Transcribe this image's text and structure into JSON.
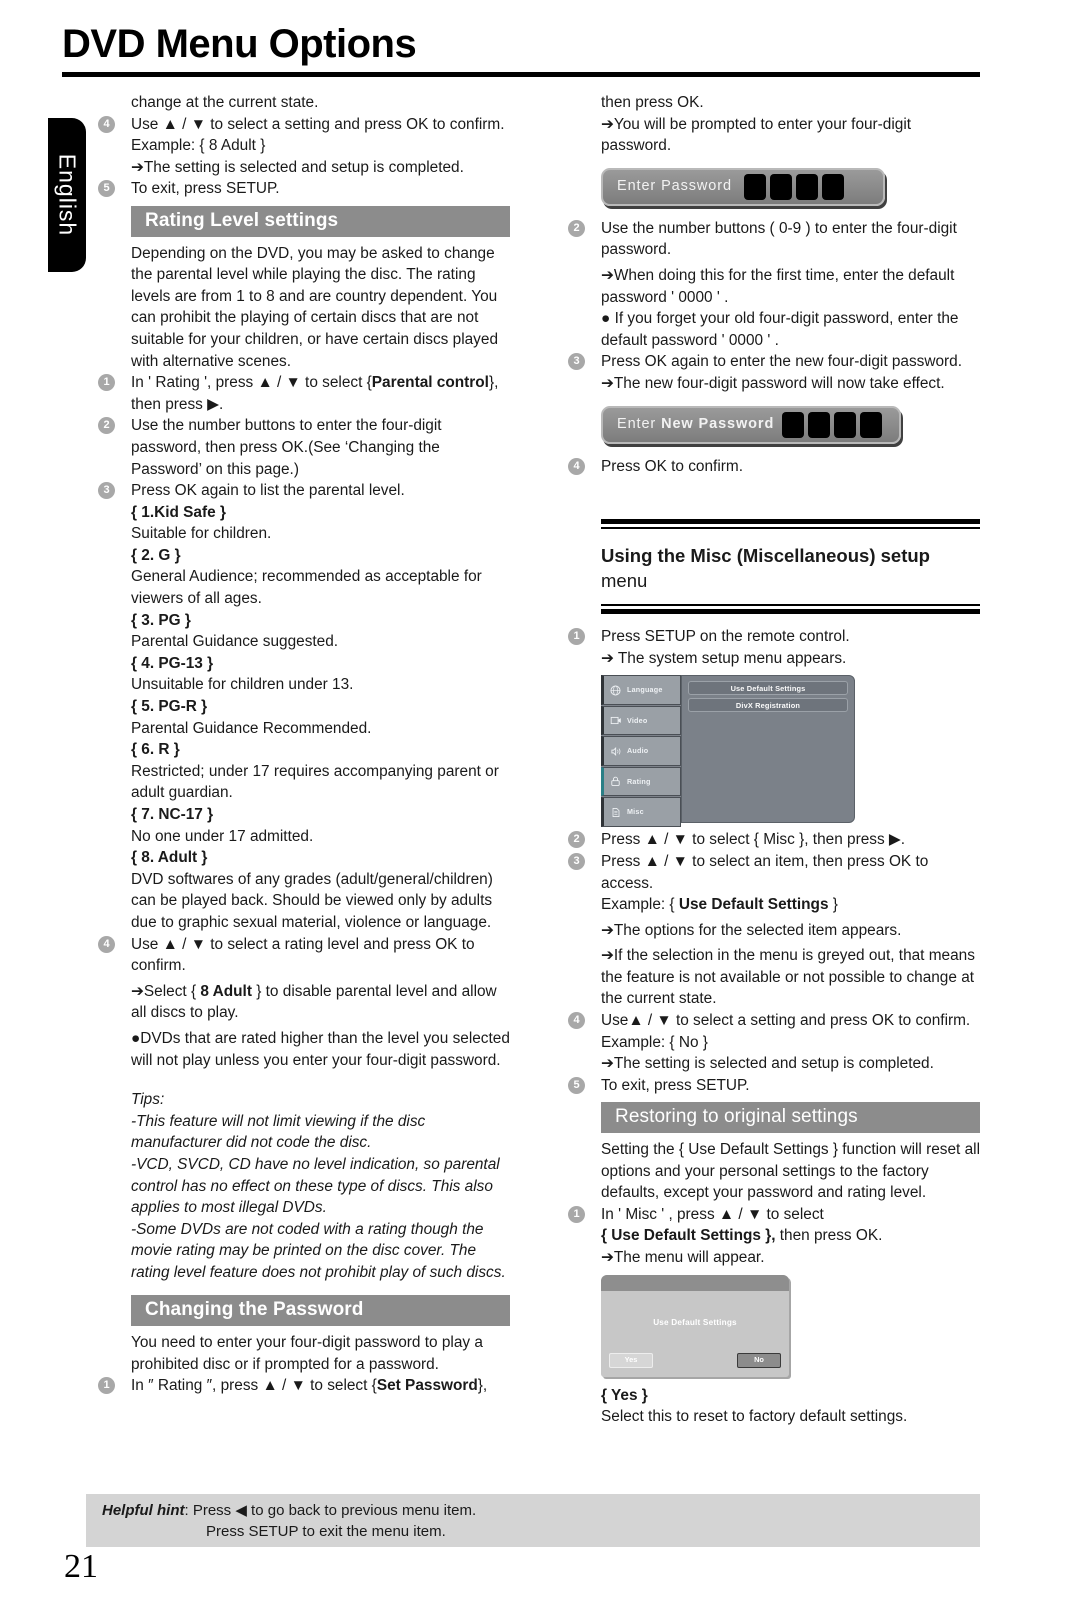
{
  "header": {
    "title": "DVD Menu Options"
  },
  "language_tab": {
    "label": "English"
  },
  "page_number": "21",
  "left_column": {
    "cont_text": "change at the current state.",
    "step4": "Use ▲ / ▼ to select a setting and press OK to confirm.",
    "step4_example": "Example: { 8 Adult }",
    "step4_arrow": "➔The setting is selected and setup is completed.",
    "step5": "To exit, press SETUP.",
    "rating_band": "Rating Level settings",
    "rating_intro": "Depending on the DVD, you may be asked to change the parental level while playing the disc. The rating levels are from 1 to 8 and are country dependent. You can prohibit the playing of certain discs that are not suitable for your children, or have certain discs played with alternative scenes.",
    "r_step1_a": "In ' Rating ', press ▲ / ▼ to select {",
    "r_step1_b": "Parental control",
    "r_step1_c": "}, then press ▶.",
    "r_step2": "Use the number buttons to enter the four-digit password, then press OK.(See ‘Changing the Password’ on this page.)",
    "r_step3": "Press OK again to list the parental level.",
    "levels": [
      {
        "name": "{ 1.Kid Safe }",
        "desc": "Suitable for children."
      },
      {
        "name": "{ 2. G }",
        "desc": "General Audience; recommended as acceptable for viewers of all ages."
      },
      {
        "name": "{ 3. PG }",
        "desc": "Parental Guidance suggested."
      },
      {
        "name": "{ 4. PG-13 }",
        "desc": "Unsuitable for children under 13."
      },
      {
        "name": "{ 5. PG-R }",
        "desc": "Parental Guidance Recommended."
      },
      {
        "name": "{ 6. R }",
        "desc": "Restricted; under 17 requires accompanying parent or adult guardian."
      },
      {
        "name": "{ 7. NC-17 }",
        "desc": "No one under 17 admitted."
      },
      {
        "name": "{ 8. Adult }",
        "desc": "DVD softwares of any grades (adult/general/children) can be played back. Should be viewed only by adults due to graphic sexual material, violence or language."
      }
    ],
    "r_step4": "Use ▲ / ▼ to select a rating level and press OK to confirm.",
    "r_step4_arrow_a": "➔Select { ",
    "r_step4_arrow_b": "8 Adult",
    "r_step4_arrow_c": " } to disable parental level and allow all discs to play.",
    "r_step4_bullet": "●DVDs that are rated higher than the level you selected will not play unless you enter your four-digit password.",
    "tips_label": "Tips:",
    "tips": [
      "-This feature will not limit viewing if the disc manufacturer did not code the disc.",
      "-VCD, SVCD, CD have no level indication, so parental control has no effect on these type of discs. This also applies to most illegal DVDs.",
      "-Some DVDs are not coded with a rating though the movie rating may be printed on the disc cover. The rating level feature does not prohibit play of such discs."
    ],
    "password_band": "Changing the Password",
    "password_intro": "You need to enter your four-digit password to play a prohibited disc or if prompted for a password.",
    "p_step1_a": "In ″ Rating ″, press ▲ / ▼ to select {",
    "p_step1_b": "Set Password",
    "p_step1_c": "},"
  },
  "right_column": {
    "cont_text": "then press OK.",
    "cont_arrow": "➔You will be prompted to enter your four-digit password.",
    "pw_bar_1": {
      "label": "Enter Password",
      "digits": 4
    },
    "p_step2": "Use the number buttons ( 0-9 ) to enter the four-digit password.",
    "p_step2_arrow": "➔When doing this for the first time, enter the default password  ' 0000  ' .",
    "p_step2_bullet": "● If you forget your old four-digit password, enter the default  password  '  0000 ' .",
    "p_step3": "Press OK again to enter the new four-digit password.",
    "p_step3_arrow": "➔The new four-digit password will now take effect.",
    "pw_bar_2": {
      "label_normal": "Enter ",
      "label_bold": "New Password",
      "digits": 4
    },
    "p_step4": "Press OK to confirm.",
    "misc_head": "Using the Misc (Miscellaneous) setup",
    "misc_head_sub": "menu",
    "m_step1": "Press SETUP on the remote control.",
    "m_step1_arrow": "➔ The system setup menu appears.",
    "dvd_menu": {
      "sidebar": [
        {
          "label": "Language",
          "icon": "globe-icon",
          "selected": false
        },
        {
          "label": "Video",
          "icon": "film-icon",
          "selected": false
        },
        {
          "label": "Audio",
          "icon": "speaker-icon",
          "selected": false
        },
        {
          "label": "Rating",
          "icon": "lock-icon",
          "selected": true
        },
        {
          "label": "Misc",
          "icon": "document-icon",
          "selected": false
        }
      ],
      "options": [
        "Use Default Settings",
        "DivX Registration"
      ]
    },
    "m_step2": "Press ▲ / ▼ to select { Misc }, then press ▶.",
    "m_step3": "Press ▲ / ▼ to select an item, then press OK to access.",
    "m_step3_example_a": "Example: { ",
    "m_step3_example_b": "Use Default Settings",
    "m_step3_example_c": " }",
    "m_step3_arrow1": "➔The options for the selected item appears.",
    "m_step3_arrow2": "➔If the selection in the menu is greyed out, that means the feature is not available or not possible to change at the current state.",
    "m_step4": "Use▲ / ▼ to select a setting and press OK to confirm.",
    "m_step4_example": "Example: { No }",
    "m_step4_arrow": "➔The setting is selected and setup is completed.",
    "m_step5": "To exit, press SETUP.",
    "restore_band": "Restoring to original settings",
    "restore_intro": "Setting the { Use Default Settings } function will reset all options and your personal settings to the factory defaults, except your password and rating level.",
    "rs_step1_a": "In  ' Misc  ' , press ▲ / ▼ to select",
    "rs_step1_b": "{ Use Default Settings },",
    "rs_step1_c": " then press OK.",
    "rs_step1_arrow": "➔The menu will appear.",
    "dialog": {
      "title": "Use Default Settings",
      "yes": "Yes",
      "no": "No"
    },
    "yes_label": "{ Yes }",
    "yes_desc": "Select this to reset to factory default settings."
  },
  "footer": {
    "hint_label": "Helpful hint",
    "hint_line1": ": Press ◀ to go back to previous menu item.",
    "hint_line2": "Press SETUP to exit the menu item."
  },
  "step_numbers": [
    "1",
    "2",
    "3",
    "4",
    "5"
  ]
}
